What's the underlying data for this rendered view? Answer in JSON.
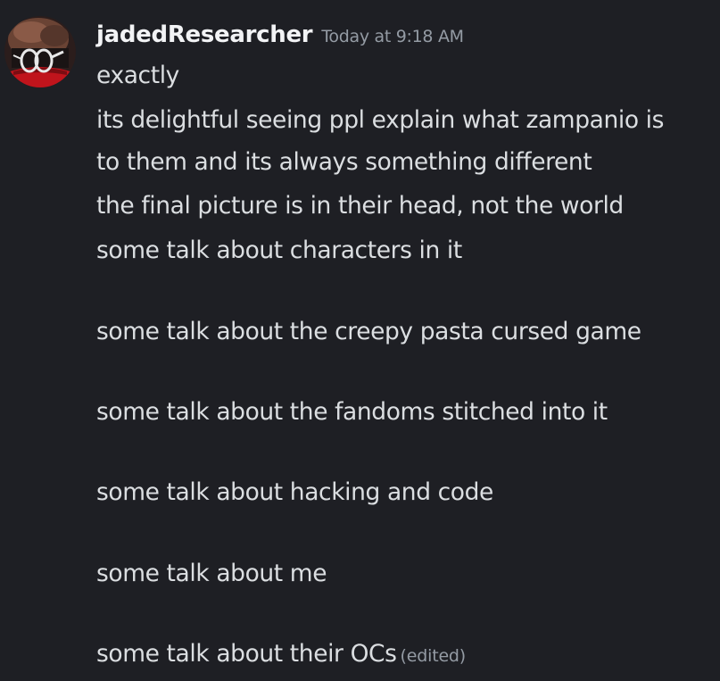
{
  "message": {
    "author": "jadedResearcher",
    "timestamp": "Today at 9:18 AM",
    "lines": [
      "exactly",
      "its delightful seeing ppl explain what zampanio is",
      "to them and its always something different",
      "the final picture is in their head, not the world",
      "some talk about characters in it",
      "some talk about the creepy pasta cursed game",
      "some talk about the fandoms stitched into it",
      "some talk about hacking and code",
      "some talk about me",
      "some talk about their OCs"
    ],
    "edited_label": "(edited)"
  },
  "colors": {
    "background": "#1e1f24",
    "username": "#f2f3f5",
    "text": "#dbdee1",
    "muted": "#949ba4"
  },
  "icons": {
    "avatar": "avatar-character-icon"
  }
}
